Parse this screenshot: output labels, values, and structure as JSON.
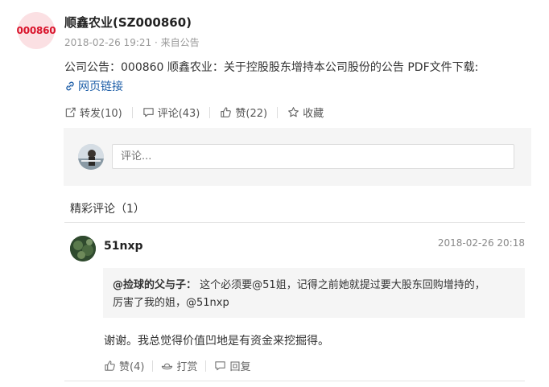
{
  "post": {
    "avatar_text": "000860",
    "author": "顺鑫农业(SZ000860)",
    "meta": "2018-02-26 19:21 · 来自公告",
    "content": "公司公告：000860 顺鑫农业：关于控股股东增持本公司股份的公告 PDF文件下载:",
    "link_label": "网页链接",
    "actions": {
      "repost": "转发(10)",
      "comment": "评论(43)",
      "like": "赞(22)",
      "favorite": "收藏"
    }
  },
  "comment_box": {
    "placeholder": "评论..."
  },
  "featured_header": "精彩评论（1）",
  "featured_comment": {
    "user": "51nxp",
    "time": "2018-02-26 20:18",
    "quote_user": "@捡球的父与子：",
    "quote_text": "这个必须要@51姐，记得之前她就提过要大股东回购增持的，",
    "quote_text2": "厉害了我的姐，@51nxp",
    "text": "谢谢。我总觉得价值凹地是有资金来挖掘得。",
    "actions": {
      "like": "赞(4)",
      "tip": "打赏",
      "reply": "回复"
    }
  },
  "colors": {
    "brand_red": "#d9132b",
    "link_blue": "#1f5fa8"
  }
}
